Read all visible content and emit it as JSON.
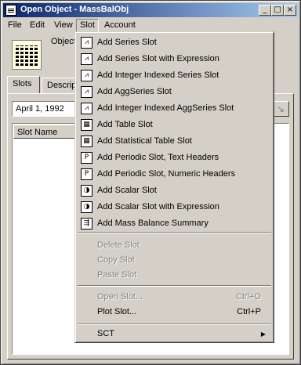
{
  "window": {
    "title": "Open Object - MassBalObj"
  },
  "titlebar_buttons": {
    "minimize": "_",
    "maximize": "□",
    "close": "×"
  },
  "menubar": {
    "file": "File",
    "edit": "Edit",
    "view": "View",
    "slot": "Slot",
    "account": "Account"
  },
  "object_label": "Object",
  "tabs": {
    "slots": "Slots",
    "description": "Descrip"
  },
  "date_value": "April 1, 1992",
  "list": {
    "header": "Slot Name"
  },
  "slot_menu": {
    "add_items": [
      {
        "label": "Add Series Slot",
        "icon": "series-icon",
        "glyph": "⩘"
      },
      {
        "label": "Add Series Slot with Expression",
        "icon": "series-expr-icon",
        "glyph": "⩘"
      },
      {
        "label": "Add Integer Indexed Series Slot",
        "icon": "integer-series-icon",
        "glyph": "⩘"
      },
      {
        "label": "Add AggSeries Slot",
        "icon": "aggseries-icon",
        "glyph": "⩘"
      },
      {
        "label": "Add Integer Indexed AggSeries Slot",
        "icon": "integer-aggseries-icon",
        "glyph": "⩘"
      },
      {
        "label": "Add Table Slot",
        "icon": "table-icon",
        "glyph": "▦"
      },
      {
        "label": "Add Statistical Table Slot",
        "icon": "stat-table-icon",
        "glyph": "▦"
      },
      {
        "label": "Add Periodic Slot, Text Headers",
        "icon": "periodic-text-icon",
        "glyph": "P"
      },
      {
        "label": "Add Periodic Slot, Numeric Headers",
        "icon": "periodic-numeric-icon",
        "glyph": "P"
      },
      {
        "label": "Add Scalar Slot",
        "icon": "scalar-icon",
        "glyph": "◑"
      },
      {
        "label": "Add Scalar Slot with Expression",
        "icon": "scalar-expr-icon",
        "glyph": "◑"
      },
      {
        "label": "Add Mass Balance Summary",
        "icon": "mass-balance-icon",
        "glyph": "⇶"
      }
    ],
    "delete_slot": "Delete Slot",
    "copy_slot": "Copy Slot",
    "paste_slot": "Paste Slot",
    "open_slot": "Open Slot...",
    "open_slot_shortcut": "Ctrl+O",
    "plot_slot": "Plot Slot...",
    "plot_slot_shortcut": "Ctrl+P",
    "sct": "SCT"
  }
}
